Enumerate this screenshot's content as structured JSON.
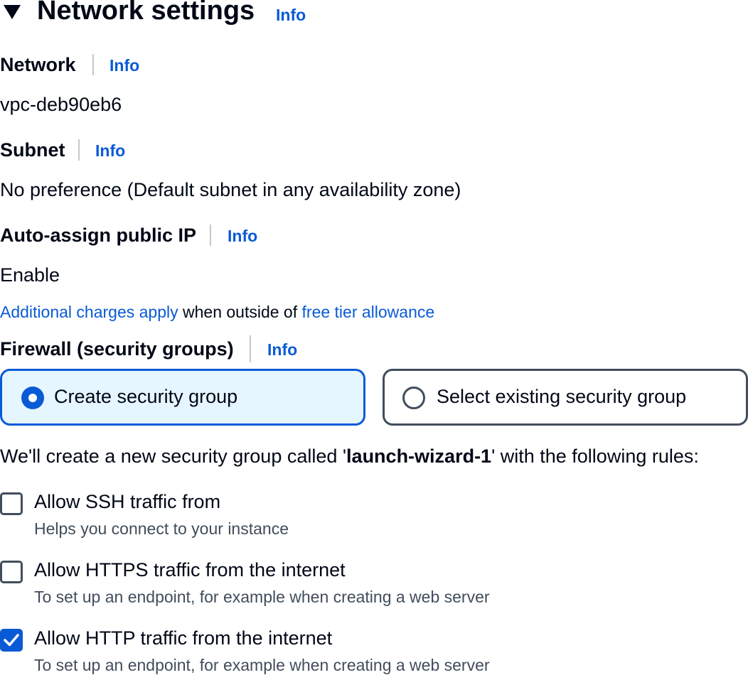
{
  "section": {
    "title": "Network settings",
    "info": "Info",
    "collapse_icon": "caret-down-icon"
  },
  "network": {
    "label": "Network",
    "info": "Info",
    "value": "vpc-deb90eb6"
  },
  "subnet": {
    "label": "Subnet",
    "info": "Info",
    "value": "No preference (Default subnet in any availability zone)"
  },
  "public_ip": {
    "label": "Auto-assign public IP",
    "info": "Info",
    "value": "Enable",
    "note_link_1": "Additional charges apply",
    "note_text": " when outside of ",
    "note_link_2": "free tier allowance"
  },
  "firewall": {
    "label": "Firewall (security groups)",
    "info": "Info",
    "options": [
      {
        "label": "Create security group",
        "selected": true
      },
      {
        "label": "Select existing security group",
        "selected": false
      }
    ],
    "description_prefix": "We'll create a new security group called '",
    "group_name": "launch-wizard-1",
    "description_suffix": "' with the following rules:"
  },
  "rules": [
    {
      "label": "Allow SSH traffic from",
      "description": "Helps you connect to your instance",
      "checked": false
    },
    {
      "label": "Allow HTTPS traffic from the internet",
      "description": "To set up an endpoint, for example when creating a web server",
      "checked": false
    },
    {
      "label": "Allow HTTP traffic from the internet",
      "description": "To set up an endpoint, for example when creating a web server",
      "checked": true
    }
  ],
  "colors": {
    "link": "#0a5ad6",
    "selected_bg": "#e6f6fe",
    "border": "#414d5c",
    "text": "#000716"
  }
}
